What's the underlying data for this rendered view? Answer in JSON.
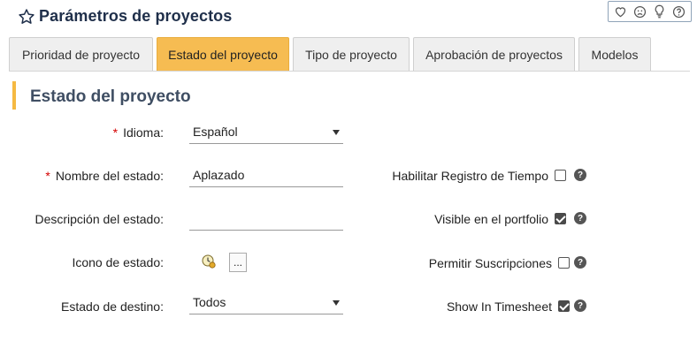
{
  "header": {
    "title": "Parámetros de proyectos",
    "feedback_icons": [
      "heart-icon",
      "sad-face-icon",
      "lightbulb-icon",
      "help-circle-icon"
    ]
  },
  "tabs": [
    {
      "label": "Prioridad de proyecto",
      "active": false
    },
    {
      "label": "Estado del proyecto",
      "active": true
    },
    {
      "label": "Tipo de proyecto",
      "active": false
    },
    {
      "label": "Aprobación de proyectos",
      "active": false
    },
    {
      "label": "Modelos",
      "active": false
    }
  ],
  "section": {
    "title": "Estado del proyecto"
  },
  "form": {
    "required_mark": "*",
    "language": {
      "label": "Idioma:",
      "value": "Español"
    },
    "status_name": {
      "label": "Nombre del estado:",
      "value": "Aplazado"
    },
    "description": {
      "label": "Descripción del estado:",
      "value": ""
    },
    "icon": {
      "label": "Icono de estado:",
      "button_label": "..."
    },
    "target_status": {
      "label": "Estado de destino:",
      "value": "Todos"
    }
  },
  "options": {
    "time_tracking": {
      "label": "Habilitar Registro de Tiempo",
      "checked": false
    },
    "visible_portfolio": {
      "label": "Visible en el portfolio",
      "checked": true
    },
    "subscriptions": {
      "label": "Permitir Suscripciones",
      "checked": false
    },
    "timesheet": {
      "label": "Show In Timesheet",
      "checked": true
    }
  },
  "help_glyph": "?",
  "colors": {
    "accent": "#f6bc52",
    "title": "#1f2f4a",
    "required": "#d40000"
  }
}
